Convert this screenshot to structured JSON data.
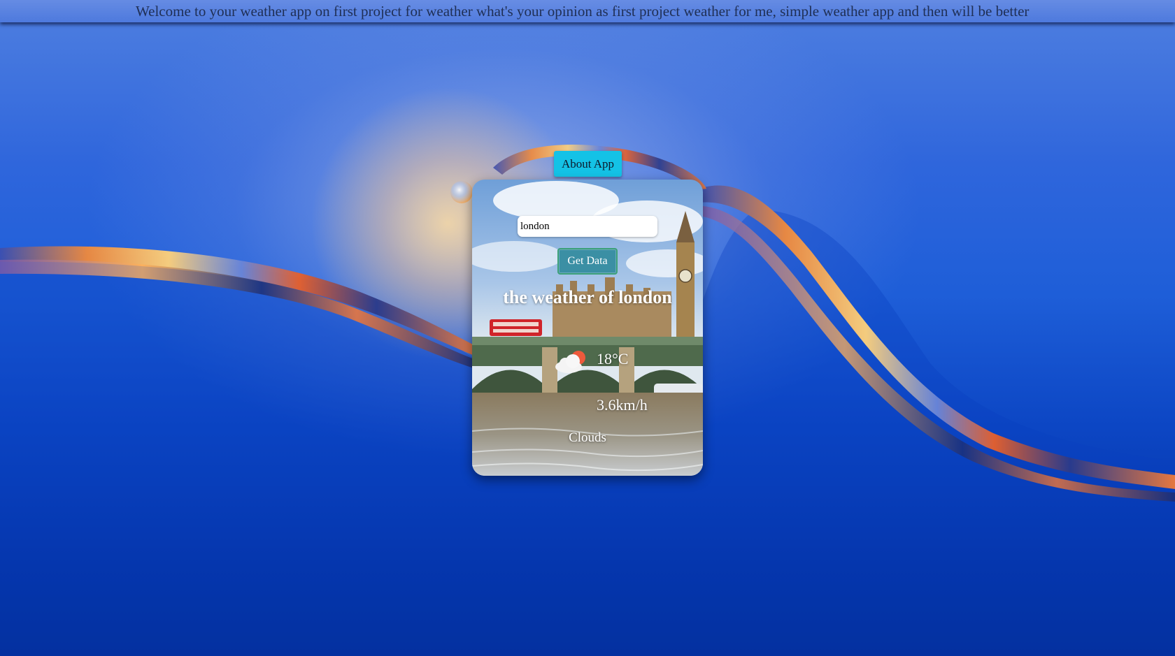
{
  "banner": {
    "text": "Welcome to your weather app on first project for weather what's your opinion as first project weather for me, simple weather app and then will be better"
  },
  "about_button": {
    "label": "About App",
    "color": "#14c2e6"
  },
  "card": {
    "search": {
      "value": "london"
    },
    "get_data_label": "Get Data",
    "title": "the weather of london",
    "weather_icon": "cloud-sun-icon",
    "temperature": "18°C",
    "wind_speed": "3.6km/h",
    "condition": "Clouds"
  }
}
